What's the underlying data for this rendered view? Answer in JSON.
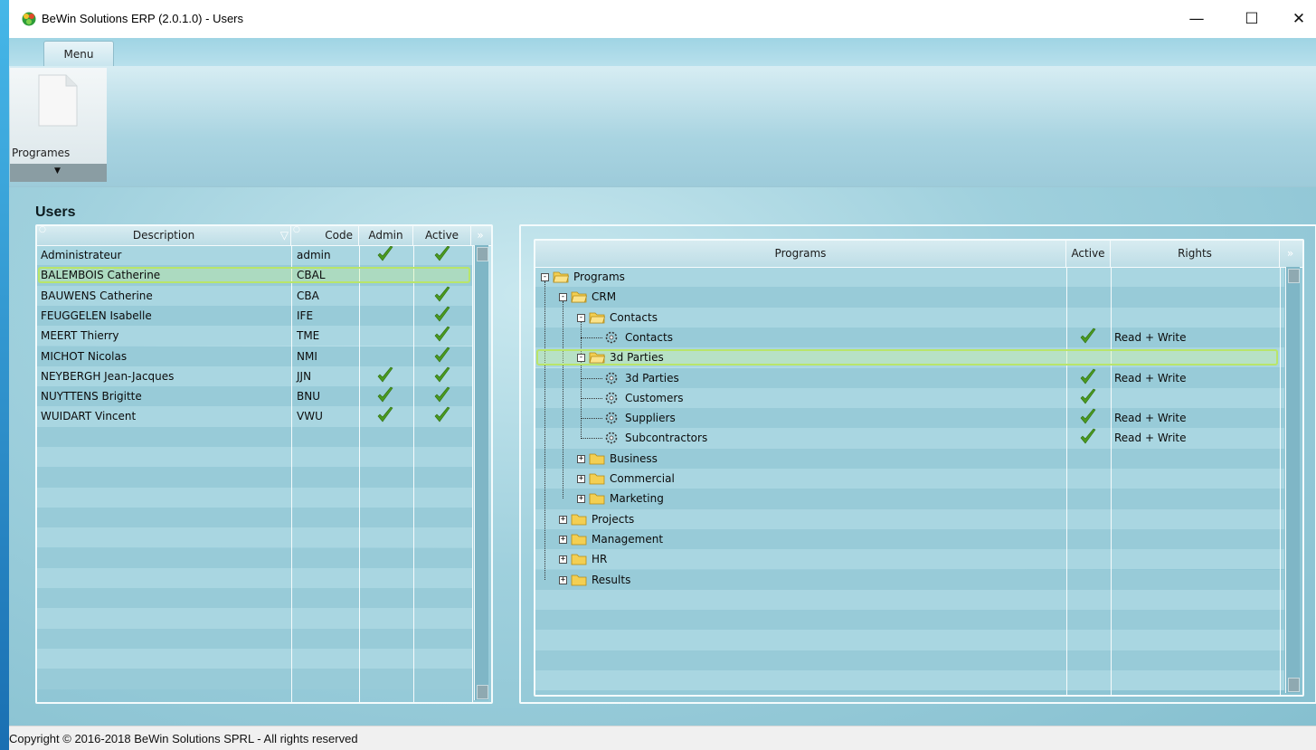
{
  "window": {
    "title": "BeWin Solutions ERP (2.0.1.0) - Users",
    "minimize_glyph": "—",
    "maximize_glyph": "☐",
    "close_glyph": "✕"
  },
  "ribbon": {
    "tab_label": "Menu",
    "programes_label": "Programes",
    "programes_arrow": "▼"
  },
  "users_panel": {
    "title": "Users",
    "columns": [
      "Description",
      "Code",
      "Admin",
      "Active"
    ],
    "rows": [
      {
        "description": "Administrateur",
        "code": "admin",
        "admin": true,
        "active": true
      },
      {
        "description": "BALEMBOIS Catherine",
        "code": "CBAL",
        "admin": false,
        "active": false
      },
      {
        "description": "BAUWENS Catherine",
        "code": "CBA",
        "admin": false,
        "active": true
      },
      {
        "description": "FEUGGELEN Isabelle",
        "code": "IFE",
        "admin": false,
        "active": true
      },
      {
        "description": "MEERT Thierry",
        "code": "TME",
        "admin": false,
        "active": true
      },
      {
        "description": "MICHOT Nicolas",
        "code": "NMI",
        "admin": false,
        "active": true
      },
      {
        "description": "NEYBERGH Jean-Jacques",
        "code": "JJN",
        "admin": true,
        "active": true
      },
      {
        "description": "NUYTTENS Brigitte",
        "code": "BNU",
        "admin": true,
        "active": true
      },
      {
        "description": "WUIDART Vincent",
        "code": "VWU",
        "admin": true,
        "active": true
      }
    ],
    "selected_row": 1
  },
  "programs_panel": {
    "columns": [
      "Programs",
      "Active",
      "Rights"
    ],
    "rows": [
      {
        "label": "Programs",
        "level": 0,
        "kind": "folder",
        "expander": "-",
        "active": false,
        "rights": ""
      },
      {
        "label": "CRM",
        "level": 1,
        "kind": "folder",
        "expander": "-",
        "active": false,
        "rights": ""
      },
      {
        "label": "Contacts",
        "level": 2,
        "kind": "folder",
        "expander": "-",
        "active": false,
        "rights": ""
      },
      {
        "label": "Contacts",
        "level": 3,
        "kind": "item",
        "expander": "",
        "active": true,
        "rights": "Read + Write"
      },
      {
        "label": "3d Parties",
        "level": 2,
        "kind": "folder",
        "expander": "-",
        "active": false,
        "rights": ""
      },
      {
        "label": "3d Parties",
        "level": 3,
        "kind": "item",
        "expander": "",
        "active": true,
        "rights": "Read + Write"
      },
      {
        "label": "Customers",
        "level": 3,
        "kind": "item",
        "expander": "",
        "active": true,
        "rights": ""
      },
      {
        "label": "Suppliers",
        "level": 3,
        "kind": "item",
        "expander": "",
        "active": true,
        "rights": "Read + Write"
      },
      {
        "label": "Subcontractors",
        "level": 3,
        "kind": "item",
        "expander": "",
        "active": true,
        "rights": "Read + Write"
      },
      {
        "label": "Business",
        "level": 2,
        "kind": "folder",
        "expander": "+",
        "active": false,
        "rights": ""
      },
      {
        "label": "Commercial",
        "level": 2,
        "kind": "folder",
        "expander": "+",
        "active": false,
        "rights": ""
      },
      {
        "label": "Marketing",
        "level": 2,
        "kind": "folder",
        "expander": "+",
        "active": false,
        "rights": ""
      },
      {
        "label": "Projects",
        "level": 1,
        "kind": "folder",
        "expander": "+",
        "active": false,
        "rights": ""
      },
      {
        "label": "Management",
        "level": 1,
        "kind": "folder",
        "expander": "+",
        "active": false,
        "rights": ""
      },
      {
        "label": "HR",
        "level": 1,
        "kind": "folder",
        "expander": "+",
        "active": false,
        "rights": ""
      },
      {
        "label": "Results",
        "level": 1,
        "kind": "folder",
        "expander": "+",
        "active": false,
        "rights": ""
      }
    ],
    "selected_row": 4
  },
  "statusbar": {
    "copyright": "Copyright © 2016-2018 BeWin Solutions SPRL - All rights reserved"
  },
  "colors": {
    "check": "#4a9a1f",
    "selection_border": "#b9e56a",
    "row_light": "#a9d6e1",
    "row_dark": "#98cbd8",
    "folder": "#f3cf52"
  }
}
